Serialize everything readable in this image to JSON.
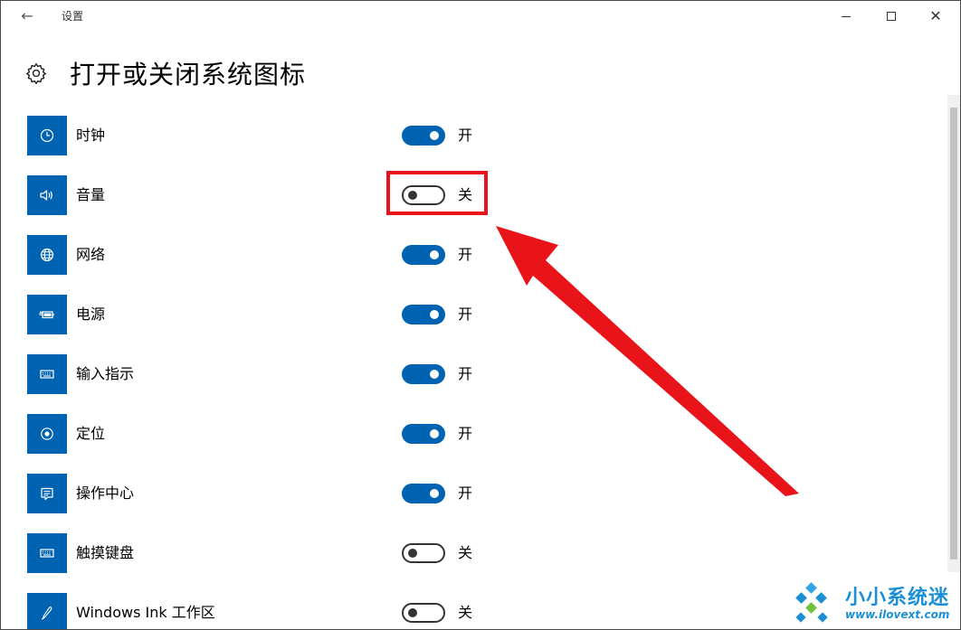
{
  "window": {
    "title": "设置",
    "back_icon": "arrow-left-icon",
    "controls": [
      "minimize",
      "maximize",
      "close"
    ],
    "close_glyph": "✕"
  },
  "page": {
    "title": "打开或关闭系统图标",
    "icon": "gear-icon"
  },
  "items": [
    {
      "label": "时钟",
      "icon": "clock-icon",
      "state": "开",
      "on": true
    },
    {
      "label": "音量",
      "icon": "volume-icon",
      "state": "关",
      "on": false
    },
    {
      "label": "网络",
      "icon": "globe-icon",
      "state": "开",
      "on": true
    },
    {
      "label": "电源",
      "icon": "battery-icon",
      "state": "开",
      "on": true
    },
    {
      "label": "输入指示",
      "icon": "keyboard-icon",
      "state": "开",
      "on": true
    },
    {
      "label": "定位",
      "icon": "location-icon",
      "state": "开",
      "on": true
    },
    {
      "label": "操作中心",
      "icon": "action-center-icon",
      "state": "开",
      "on": true
    },
    {
      "label": "触摸键盘",
      "icon": "touch-keyboard-icon",
      "state": "关",
      "on": false
    },
    {
      "label": "Windows Ink 工作区",
      "icon": "pen-icon",
      "state": "关",
      "on": false
    }
  ],
  "annotation": {
    "highlight_color": "#e8141a",
    "highlighted_item": "音量"
  },
  "colors": {
    "accent": "#0063b1",
    "annotation_red": "#e8141a",
    "watermark_blue": "#1b8fd6"
  },
  "watermark": {
    "name": "小小系统迷",
    "url": "www.ilovext.com"
  }
}
